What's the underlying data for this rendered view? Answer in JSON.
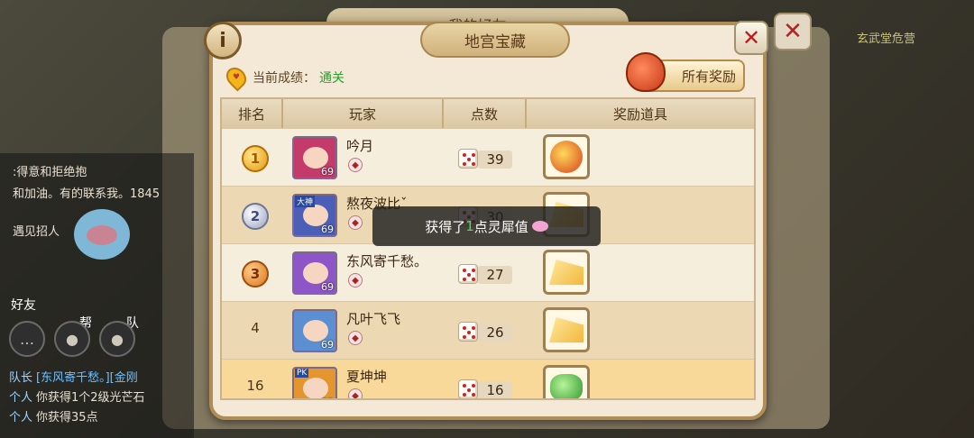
{
  "background": {
    "friends_title": "我的好友",
    "top_right_label": "玄武堂危营",
    "chat_top": ":得意和拒绝抱",
    "chat_tag": "和加油。有的联系我。1845",
    "invite_text": "遇见招人",
    "friend_label": "好友",
    "help_label": "帮",
    "team_label": "队",
    "chat_lines": [
      {
        "prefix": "队长",
        "text": "[东风寄千愁。][金刚",
        "color": "#6fc0ff"
      },
      {
        "prefix": "个人",
        "text": "你获得1个2级光芒石",
        "color": "#e6e0d0"
      },
      {
        "prefix": "个人",
        "text": "你获得35点",
        "color": "#e6e0d0"
      }
    ]
  },
  "dialog": {
    "title": "地宫宝藏",
    "info_label": "i",
    "close_label": "✕",
    "score_label": "当前成绩：",
    "score_value": "通关",
    "all_rewards_label": "所有奖励"
  },
  "table": {
    "headers": [
      "排名",
      "玩家",
      "点数",
      "奖励道具"
    ],
    "rows": [
      {
        "rank": "1",
        "name": "吟月",
        "level": "69",
        "points": "39",
        "reward": "red-bag-icon",
        "style": "odd",
        "rank_style": "gold",
        "avatar_color": "#c43a6b"
      },
      {
        "rank": "2",
        "name": "熬夜波比ˇ",
        "level": "69",
        "points": "30",
        "reward": "cheese-icon",
        "style": "even",
        "rank_style": "silver",
        "avatar_color": "#4b5fb8",
        "badge": "大神"
      },
      {
        "rank": "3",
        "name": "东风寄千愁。",
        "level": "69",
        "points": "27",
        "reward": "cheese-icon",
        "style": "odd",
        "rank_style": "bronze",
        "avatar_color": "#8d55c8"
      },
      {
        "rank": "4",
        "name": "凡叶飞飞",
        "level": "69",
        "points": "26",
        "reward": "cheese-icon",
        "style": "even",
        "rank_style": "plain",
        "avatar_color": "#5c8fd1"
      },
      {
        "rank": "16",
        "name": "夏坤坤",
        "level": "69",
        "points": "16",
        "reward": "green-gem-icon",
        "style": "mine",
        "rank_style": "plain",
        "avatar_color": "#e3962d",
        "badge": "PK"
      }
    ]
  },
  "toast": {
    "prefix": "获得了",
    "amount": "1",
    "suffix": "点灵犀值"
  }
}
